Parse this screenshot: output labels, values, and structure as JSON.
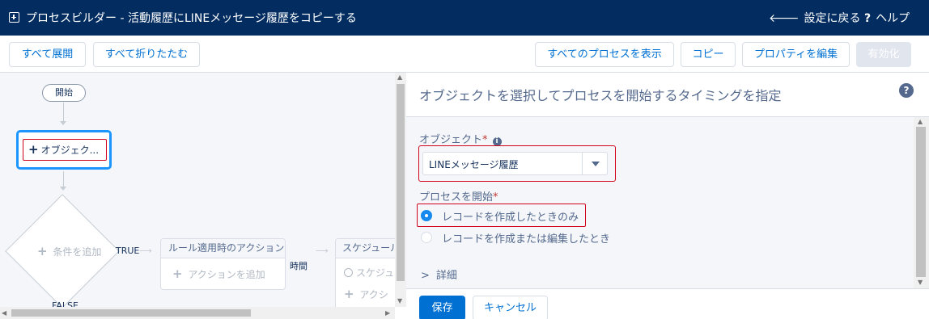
{
  "header": {
    "title": "プロセスビルダー - 活動履歴にLINEメッセージ履歴をコピーする",
    "back_label": "設定に戻る",
    "help_label": "ヘルプ"
  },
  "toolbar": {
    "expand_all": "すべて展開",
    "collapse_all": "すべて折りたたむ",
    "view_all_processes": "すべてのプロセスを表示",
    "copy": "コピー",
    "edit_properties": "プロパティを編集",
    "activate": "有効化"
  },
  "canvas": {
    "start_label": "開始",
    "object_node_label": "オブジェク...",
    "condition_placeholder": "条件を追加",
    "true_label": "TRUE",
    "false_label": "FALSE",
    "immediate_actions_header": "ルール適用時のアクション",
    "add_action_label": "アクションを追加",
    "time_label": "時間",
    "scheduled_header": "スケジュール",
    "scheduled_row": "スケジュ",
    "scheduled_add": "アクシ"
  },
  "panel": {
    "title": "オブジェクトを選択してプロセスを開始するタイミングを指定",
    "object_label": "オブジェクト",
    "object_value": "LINEメッセージ履歴",
    "start_label": "プロセスを開始",
    "radio_options": [
      {
        "label": "レコードを作成したときのみ",
        "checked": true
      },
      {
        "label": "レコードを作成または編集したとき",
        "checked": false
      }
    ],
    "details_label": "詳細",
    "save_label": "保存",
    "cancel_label": "キャンセル"
  },
  "colors": {
    "header_bg": "#032d60",
    "brand_blue": "#0070d2",
    "highlight_red": "#d0021b",
    "selection_blue": "#1b96ff"
  }
}
